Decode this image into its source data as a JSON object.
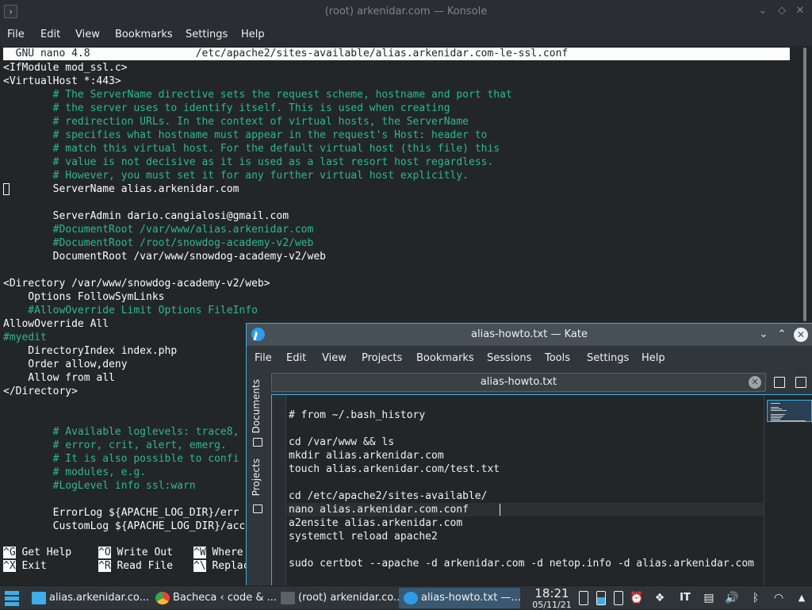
{
  "konsole": {
    "title": "(root) arkenidar.com — Konsole",
    "menu": [
      "File",
      "Edit",
      "View",
      "Bookmarks",
      "Settings",
      "Help"
    ],
    "nano_header": "  GNU nano 4.8                 /etc/apache2/sites-available/alias.arkenidar.com-le-ssl.conf",
    "lines": [
      "<IfModule mod_ssl.c>",
      "<VirtualHost *:443>",
      "        # The ServerName directive sets the request scheme, hostname and port that",
      "        # the server uses to identify itself. This is used when creating",
      "        # redirection URLs. In the context of virtual hosts, the ServerName",
      "        # specifies what hostname must appear in the request's Host: header to",
      "        # match this virtual host. For the default virtual host (this file) this",
      "        # value is not decisive as it is used as a last resort host regardless.",
      "        # However, you must set it for any further virtual host explicitly.",
      "        ServerName alias.arkenidar.com",
      "",
      "        ServerAdmin dario.cangialosi@gmail.com",
      "        #DocumentRoot /var/www/alias.arkenidar.com",
      "        #DocumentRoot /root/snowdog-academy-v2/web",
      "        DocumentRoot /var/www/snowdog-academy-v2/web",
      "",
      "<Directory /var/www/snowdog-academy-v2/web>",
      "    Options FollowSymLinks",
      "    #AllowOverride Limit Options FileInfo",
      "AllowOverride All",
      "#myedit",
      "    DirectoryIndex index.php",
      "    Order allow,deny",
      "    Allow from all",
      "</Directory>",
      "",
      "",
      "        # Available loglevels: trace8,",
      "        # error, crit, alert, emerg.",
      "        # It is also possible to confi",
      "        # modules, e.g.",
      "        #LogLevel info ssl:warn",
      "",
      "        ErrorLog ${APACHE_LOG_DIR}/err",
      "        CustomLog ${APACHE_LOG_DIR}/acc"
    ],
    "shortcuts": [
      {
        "key": "^G",
        "label": " Get Help"
      },
      {
        "key": "^O",
        "label": " Write Out"
      },
      {
        "key": "^W",
        "label": " Where"
      },
      {
        "key": "^X",
        "label": " Exit"
      },
      {
        "key": "^R",
        "label": " Read File"
      },
      {
        "key": "^\\",
        "label": " Replac"
      }
    ]
  },
  "kate": {
    "title": "alias-howto.txt — Kate",
    "menu": [
      "File",
      "Edit",
      "View",
      "Projects",
      "Bookmarks",
      "Sessions",
      "Tools",
      "Settings",
      "Help"
    ],
    "side_tabs": [
      "Documents",
      "Projects"
    ],
    "tab": "alias-howto.txt",
    "lines": [
      "# from ~/.bash_history",
      "",
      "cd /var/www && ls",
      "mkdir alias.arkenidar.com",
      "touch alias.arkenidar.com/test.txt",
      "",
      "cd /etc/apache2/sites-available/",
      "nano alias.arkenidar.com.conf ",
      "a2ensite alias.arkenidar.com",
      "systemctl reload apache2",
      "",
      "sudo certbot --apache -d arkenidar.com -d netop.info -d alias.arkenidar.com"
    ]
  },
  "taskbar": {
    "tasks": [
      {
        "label": "alias.arkenidar.co...",
        "icon": "dolphin-icon",
        "color": "#3daee9"
      },
      {
        "label": "Bacheca ‹ code & ...",
        "icon": "chrome-icon",
        "color": "#e8453c"
      },
      {
        "label": "(root) arkenidar.co...",
        "icon": "konsole-icon",
        "color": "#5c6166"
      },
      {
        "label": "alias-howto.txt  —...",
        "icon": "kate-icon",
        "color": "#2e9ce8"
      }
    ],
    "clock_time": "18:21",
    "clock_date": "05/11/21",
    "lang": "IT"
  }
}
